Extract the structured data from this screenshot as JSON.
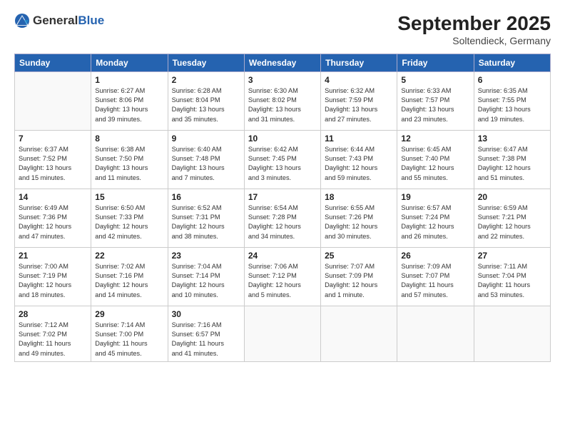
{
  "header": {
    "logo_general": "General",
    "logo_blue": "Blue",
    "month_title": "September 2025",
    "location": "Soltendieck, Germany"
  },
  "weekdays": [
    "Sunday",
    "Monday",
    "Tuesday",
    "Wednesday",
    "Thursday",
    "Friday",
    "Saturday"
  ],
  "weeks": [
    [
      {
        "day": "",
        "detail": ""
      },
      {
        "day": "1",
        "detail": "Sunrise: 6:27 AM\nSunset: 8:06 PM\nDaylight: 13 hours\nand 39 minutes."
      },
      {
        "day": "2",
        "detail": "Sunrise: 6:28 AM\nSunset: 8:04 PM\nDaylight: 13 hours\nand 35 minutes."
      },
      {
        "day": "3",
        "detail": "Sunrise: 6:30 AM\nSunset: 8:02 PM\nDaylight: 13 hours\nand 31 minutes."
      },
      {
        "day": "4",
        "detail": "Sunrise: 6:32 AM\nSunset: 7:59 PM\nDaylight: 13 hours\nand 27 minutes."
      },
      {
        "day": "5",
        "detail": "Sunrise: 6:33 AM\nSunset: 7:57 PM\nDaylight: 13 hours\nand 23 minutes."
      },
      {
        "day": "6",
        "detail": "Sunrise: 6:35 AM\nSunset: 7:55 PM\nDaylight: 13 hours\nand 19 minutes."
      }
    ],
    [
      {
        "day": "7",
        "detail": "Sunrise: 6:37 AM\nSunset: 7:52 PM\nDaylight: 13 hours\nand 15 minutes."
      },
      {
        "day": "8",
        "detail": "Sunrise: 6:38 AM\nSunset: 7:50 PM\nDaylight: 13 hours\nand 11 minutes."
      },
      {
        "day": "9",
        "detail": "Sunrise: 6:40 AM\nSunset: 7:48 PM\nDaylight: 13 hours\nand 7 minutes."
      },
      {
        "day": "10",
        "detail": "Sunrise: 6:42 AM\nSunset: 7:45 PM\nDaylight: 13 hours\nand 3 minutes."
      },
      {
        "day": "11",
        "detail": "Sunrise: 6:44 AM\nSunset: 7:43 PM\nDaylight: 12 hours\nand 59 minutes."
      },
      {
        "day": "12",
        "detail": "Sunrise: 6:45 AM\nSunset: 7:40 PM\nDaylight: 12 hours\nand 55 minutes."
      },
      {
        "day": "13",
        "detail": "Sunrise: 6:47 AM\nSunset: 7:38 PM\nDaylight: 12 hours\nand 51 minutes."
      }
    ],
    [
      {
        "day": "14",
        "detail": "Sunrise: 6:49 AM\nSunset: 7:36 PM\nDaylight: 12 hours\nand 47 minutes."
      },
      {
        "day": "15",
        "detail": "Sunrise: 6:50 AM\nSunset: 7:33 PM\nDaylight: 12 hours\nand 42 minutes."
      },
      {
        "day": "16",
        "detail": "Sunrise: 6:52 AM\nSunset: 7:31 PM\nDaylight: 12 hours\nand 38 minutes."
      },
      {
        "day": "17",
        "detail": "Sunrise: 6:54 AM\nSunset: 7:28 PM\nDaylight: 12 hours\nand 34 minutes."
      },
      {
        "day": "18",
        "detail": "Sunrise: 6:55 AM\nSunset: 7:26 PM\nDaylight: 12 hours\nand 30 minutes."
      },
      {
        "day": "19",
        "detail": "Sunrise: 6:57 AM\nSunset: 7:24 PM\nDaylight: 12 hours\nand 26 minutes."
      },
      {
        "day": "20",
        "detail": "Sunrise: 6:59 AM\nSunset: 7:21 PM\nDaylight: 12 hours\nand 22 minutes."
      }
    ],
    [
      {
        "day": "21",
        "detail": "Sunrise: 7:00 AM\nSunset: 7:19 PM\nDaylight: 12 hours\nand 18 minutes."
      },
      {
        "day": "22",
        "detail": "Sunrise: 7:02 AM\nSunset: 7:16 PM\nDaylight: 12 hours\nand 14 minutes."
      },
      {
        "day": "23",
        "detail": "Sunrise: 7:04 AM\nSunset: 7:14 PM\nDaylight: 12 hours\nand 10 minutes."
      },
      {
        "day": "24",
        "detail": "Sunrise: 7:06 AM\nSunset: 7:12 PM\nDaylight: 12 hours\nand 5 minutes."
      },
      {
        "day": "25",
        "detail": "Sunrise: 7:07 AM\nSunset: 7:09 PM\nDaylight: 12 hours\nand 1 minute."
      },
      {
        "day": "26",
        "detail": "Sunrise: 7:09 AM\nSunset: 7:07 PM\nDaylight: 11 hours\nand 57 minutes."
      },
      {
        "day": "27",
        "detail": "Sunrise: 7:11 AM\nSunset: 7:04 PM\nDaylight: 11 hours\nand 53 minutes."
      }
    ],
    [
      {
        "day": "28",
        "detail": "Sunrise: 7:12 AM\nSunset: 7:02 PM\nDaylight: 11 hours\nand 49 minutes."
      },
      {
        "day": "29",
        "detail": "Sunrise: 7:14 AM\nSunset: 7:00 PM\nDaylight: 11 hours\nand 45 minutes."
      },
      {
        "day": "30",
        "detail": "Sunrise: 7:16 AM\nSunset: 6:57 PM\nDaylight: 11 hours\nand 41 minutes."
      },
      {
        "day": "",
        "detail": ""
      },
      {
        "day": "",
        "detail": ""
      },
      {
        "day": "",
        "detail": ""
      },
      {
        "day": "",
        "detail": ""
      }
    ]
  ]
}
